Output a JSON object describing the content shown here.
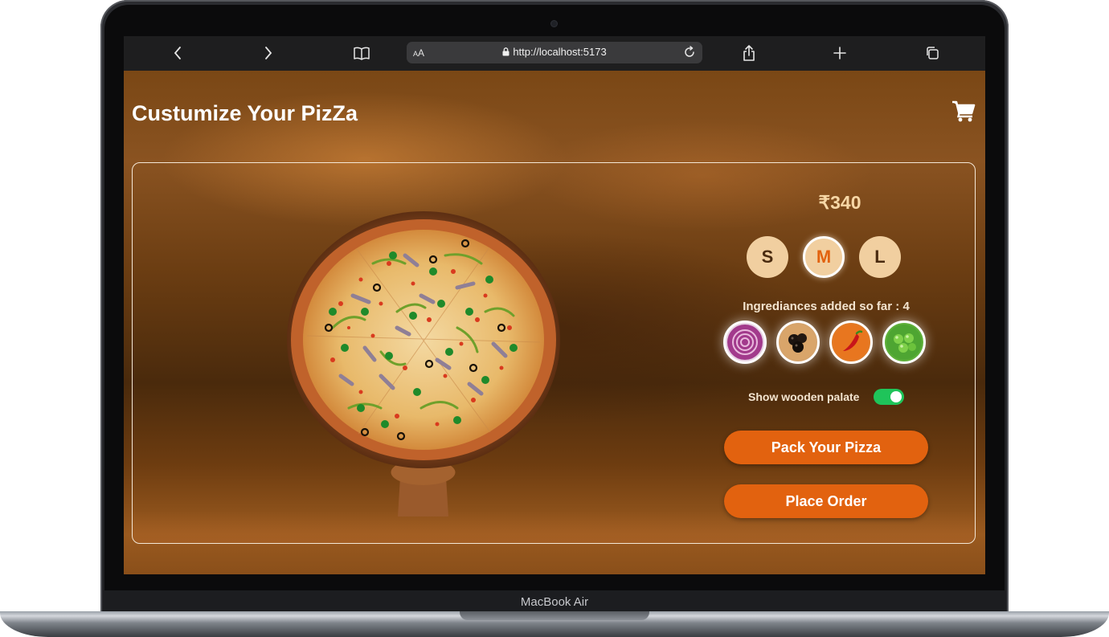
{
  "device": {
    "label": "MacBook Air"
  },
  "browser": {
    "text_size_label": "AA",
    "url": "http://localhost:5173"
  },
  "page": {
    "title": "Custumize Your PizZa"
  },
  "product": {
    "price": "₹340",
    "sizes": [
      "S",
      "M",
      "L"
    ],
    "selected_size": "M"
  },
  "ingredients": {
    "label": "Ingrediances added so far : 4",
    "items": [
      "onion-icon",
      "olives-icon",
      "chili-pepper-icon",
      "green-peas-icon"
    ]
  },
  "options": {
    "wooden_palate_label": "Show wooden palate",
    "wooden_palate_on": true
  },
  "actions": {
    "pack_label": "Pack Your Pizza",
    "order_label": "Place Order"
  },
  "colors": {
    "accent": "#e2620f",
    "toggle_on": "#1fc45a",
    "price": "#f7d7a6",
    "size_chip": "#f1cfa0"
  }
}
